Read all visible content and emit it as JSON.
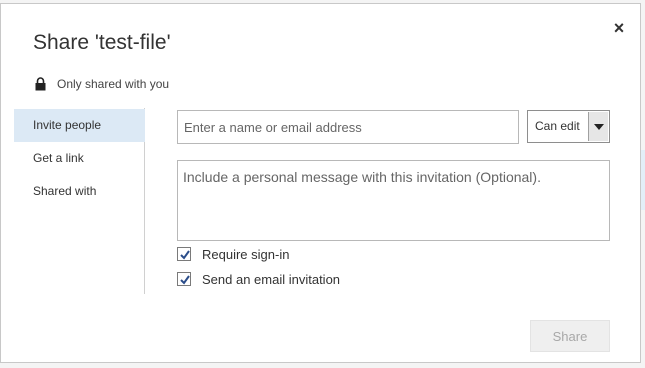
{
  "dialog": {
    "title": "Share 'test-file'",
    "close_label": "×",
    "status": {
      "icon": "lock-icon",
      "text": "Only shared with you"
    }
  },
  "nav": {
    "items": [
      {
        "label": "Invite people",
        "active": true
      },
      {
        "label": "Get a link",
        "active": false
      },
      {
        "label": "Shared with",
        "active": false
      }
    ]
  },
  "invite": {
    "name_placeholder": "Enter a name or email address",
    "name_value": "",
    "permission": "Can edit",
    "message_placeholder": "Include a personal message with this invitation (Optional).",
    "message_value": "",
    "require_signin_label": "Require sign-in",
    "require_signin_checked": true,
    "send_email_label": "Send an email invitation",
    "send_email_checked": true
  },
  "footer": {
    "share_label": "Share",
    "share_enabled": false
  },
  "colors": {
    "accent_nav_active": "#dce9f5",
    "title_text": "#333333",
    "disabled_button_text": "#a8a8a8"
  }
}
